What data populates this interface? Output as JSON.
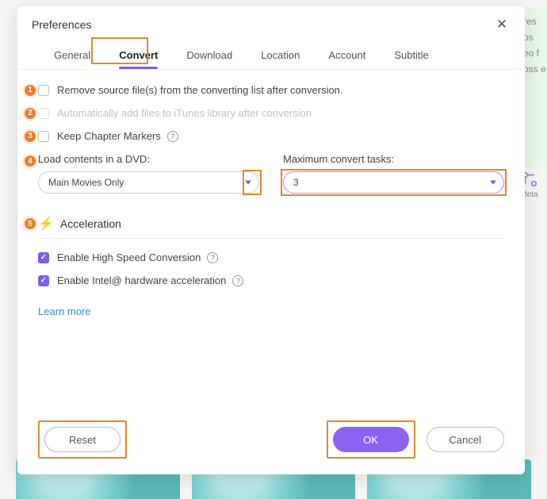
{
  "modal": {
    "title": "Preferences"
  },
  "tabs": [
    "General",
    "Convert",
    "Download",
    "Location",
    "Account",
    "Subtitle"
  ],
  "active_tab": "Convert",
  "opts": {
    "remove_source": "Remove source file(s) from the converting list after conversion.",
    "auto_itunes": "Automatically add files to iTunes library after conversion",
    "keep_chapter": "Keep Chapter Markers"
  },
  "dvd": {
    "label": "Load contents in a DVD:",
    "value": "Main Movies Only"
  },
  "tasks": {
    "label": "Maximum convert tasks:",
    "value": "3"
  },
  "accel": {
    "title": "Acceleration",
    "high_speed": "Enable High Speed Conversion",
    "intel": "Enable Intel@ hardware acceleration",
    "learn_more": "Learn more"
  },
  "buttons": {
    "reset": "Reset",
    "ok": "OK",
    "cancel": "Cancel"
  },
  "side": {
    "l1": "res",
    "l2": "os",
    "l3": "eo f",
    "l4": "oss e",
    "meta": "Meta"
  },
  "badges": [
    "1",
    "2",
    "3",
    "4",
    "5"
  ]
}
